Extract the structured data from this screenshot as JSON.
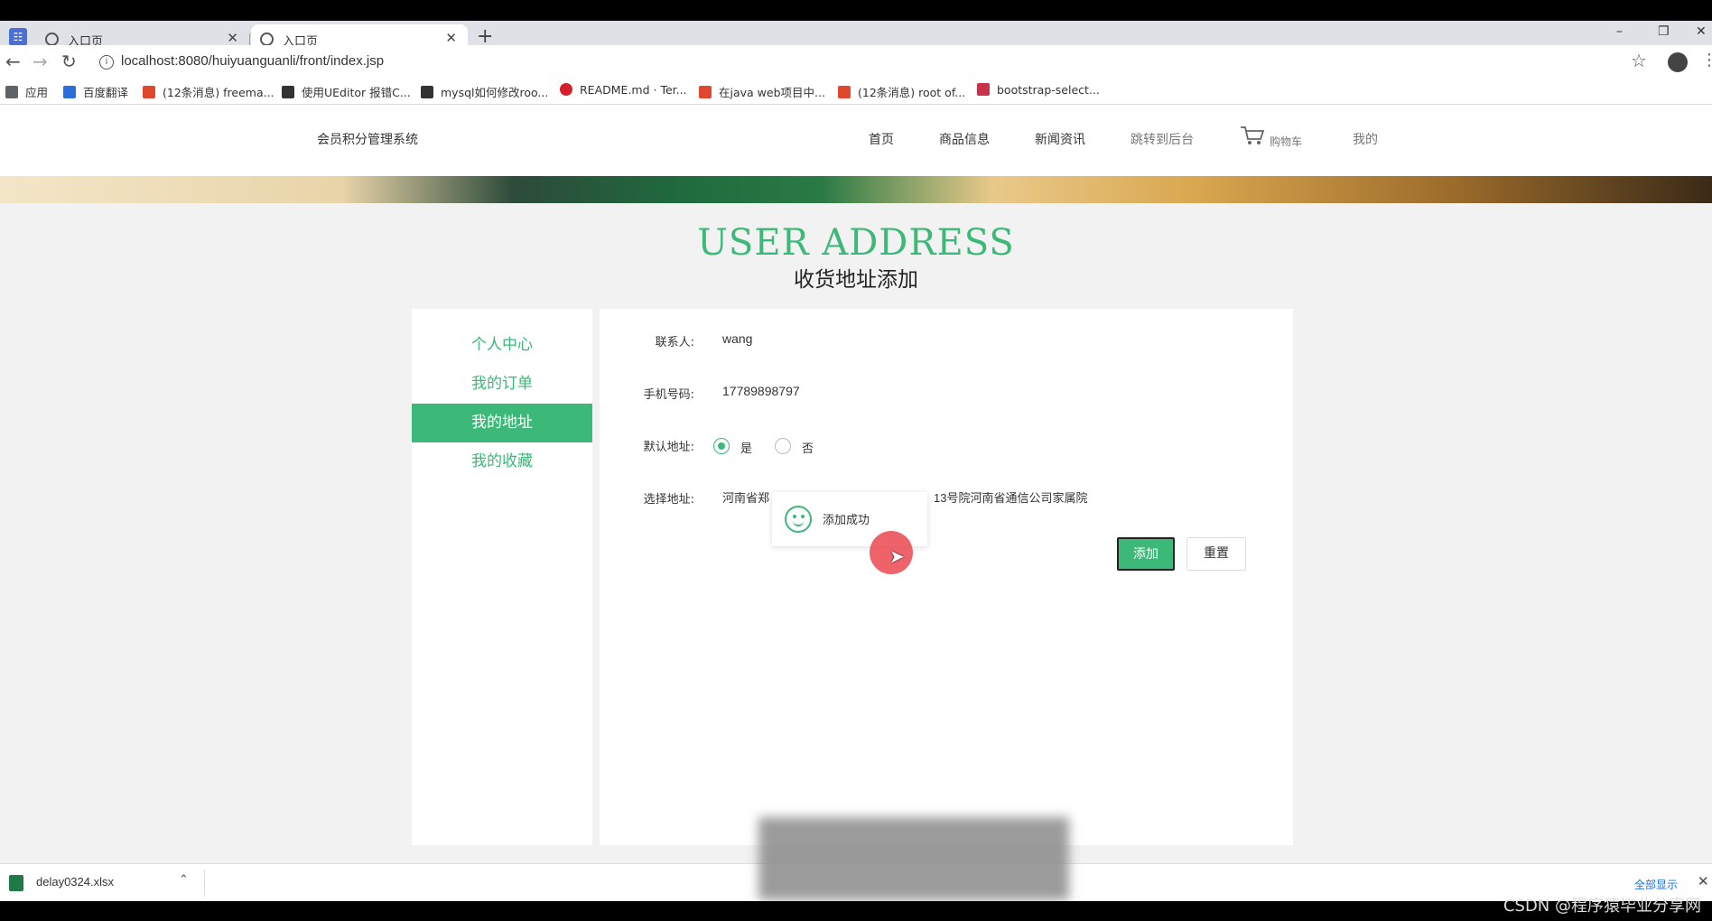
{
  "browser": {
    "tabs": [
      {
        "title": "入口页",
        "active": false
      },
      {
        "title": "入口页",
        "active": true
      }
    ],
    "new_tab": "+",
    "window_controls": {
      "minimize": "–",
      "restore": "❐",
      "close": "✕"
    },
    "url": "localhost:8080/huiyuanguanli/front/index.jsp",
    "bookmarks": [
      {
        "label": "应用",
        "color": "#5f6368"
      },
      {
        "label": "百度翻译",
        "color": "#2b6fd6"
      },
      {
        "label": "(12条消息) freema...",
        "color": "#e0472f"
      },
      {
        "label": "使用UEditor 报错C...",
        "color": "#333333"
      },
      {
        "label": "mysql如何修改roo...",
        "color": "#333333"
      },
      {
        "label": "README.md · Ter...",
        "color": "#d3202b"
      },
      {
        "label": "在java web项目中...",
        "color": "#e0472f"
      },
      {
        "label": "(12条消息) root of...",
        "color": "#e0472f"
      },
      {
        "label": "bootstrap-select...",
        "color": "#c8334a"
      }
    ]
  },
  "site": {
    "brand": "会员积分管理系统",
    "nav": [
      "首页",
      "商品信息",
      "新闻资讯",
      "跳转到后台",
      "购物车",
      "我的"
    ],
    "accent": "#3cb878"
  },
  "section": {
    "title": "USER ADDRESS",
    "subtitle": "收货地址添加"
  },
  "sidebar": {
    "items": [
      {
        "label": "个人中心",
        "active": false
      },
      {
        "label": "我的订单",
        "active": false
      },
      {
        "label": "我的地址",
        "active": true
      },
      {
        "label": "我的收藏",
        "active": false
      }
    ]
  },
  "form": {
    "contact_label": "联系人:",
    "contact_value": "wang",
    "phone_label": "手机号码:",
    "phone_value": "17789898797",
    "default_label": "默认地址:",
    "default_yes": "是",
    "default_no": "否",
    "default_selected": "是",
    "address_label": "选择地址:",
    "address_value_left": "河南省郑",
    "address_value_right": "13号院河南省通信公司家属院",
    "add_button": "添加",
    "reset_button": "重置"
  },
  "toast": {
    "text": "添加成功",
    "icon": "smile-icon"
  },
  "downloads": {
    "file": "delay0324.xlsx",
    "show_all": "全部显示"
  },
  "watermark": "CSDN @程序猿毕业分享网"
}
